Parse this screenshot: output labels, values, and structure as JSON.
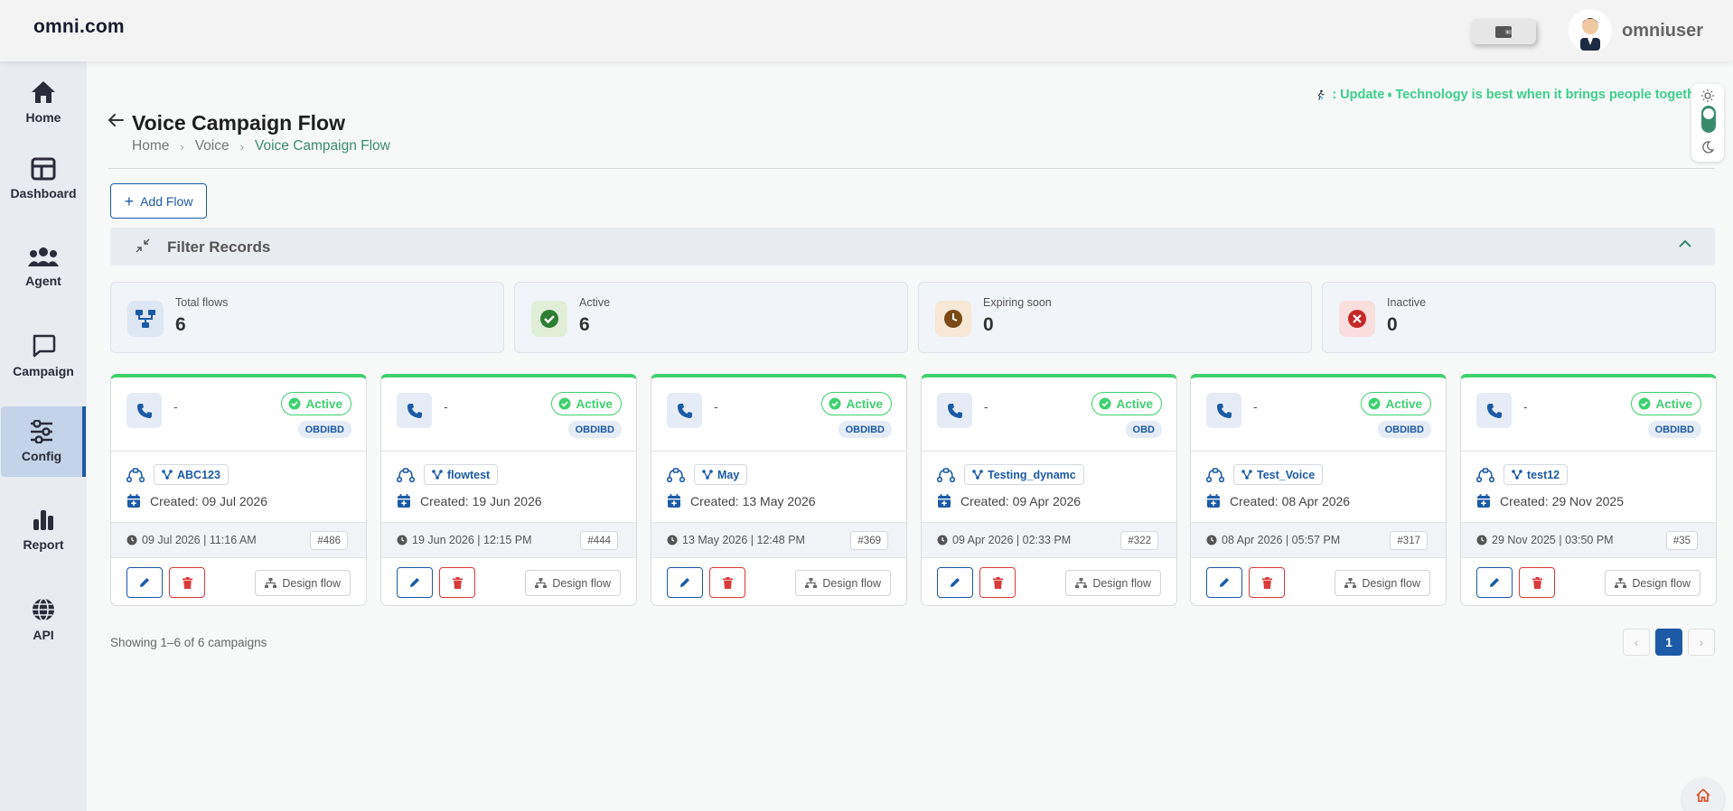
{
  "brand": "omni.com",
  "user": {
    "name": "omniuser"
  },
  "sidebar": {
    "items": [
      {
        "label": "Home",
        "icon": "home-icon"
      },
      {
        "label": "Dashboard",
        "icon": "dashboard-icon"
      },
      {
        "label": "Agent",
        "icon": "agents-icon"
      },
      {
        "label": "Campaign",
        "icon": "campaign-icon"
      },
      {
        "label": "Config",
        "icon": "config-icon",
        "active": true
      },
      {
        "label": "Report",
        "icon": "report-icon"
      },
      {
        "label": "API",
        "icon": "globe-icon"
      }
    ]
  },
  "ticker": {
    "label": ": Update",
    "text": "Technology is best when it brings people togeth"
  },
  "page": {
    "title": "Voice Campaign Flow",
    "breadcrumb": [
      "Home",
      "Voice",
      "Voice Campaign Flow"
    ],
    "add_flow": "Add Flow",
    "filter_label": "Filter Records"
  },
  "stats": [
    {
      "label": "Total flows",
      "value": "6",
      "icon": "flow-icon",
      "color": "#1c5aa6"
    },
    {
      "label": "Active",
      "value": "6",
      "icon": "check-circle-icon",
      "color": "#2e8b3d"
    },
    {
      "label": "Expiring soon",
      "value": "0",
      "icon": "clock-icon",
      "color": "#8a5a1c"
    },
    {
      "label": "Inactive",
      "value": "0",
      "icon": "x-circle-icon",
      "color": "#c0392b"
    }
  ],
  "flows": [
    {
      "name": "-",
      "status": "Active",
      "type": "OBDIBD",
      "flow": "ABC123",
      "created": "Created: 09 Jul 2026",
      "timestamp": "09 Jul 2026 | 11:16 AM",
      "id": "#486",
      "design": "Design flow"
    },
    {
      "name": "-",
      "status": "Active",
      "type": "OBDIBD",
      "flow": "flowtest",
      "created": "Created: 19 Jun 2026",
      "timestamp": "19 Jun 2026 | 12:15 PM",
      "id": "#444",
      "design": "Design flow"
    },
    {
      "name": "-",
      "status": "Active",
      "type": "OBDIBD",
      "flow": "May",
      "created": "Created: 13 May 2026",
      "timestamp": "13 May 2026 | 12:48 PM",
      "id": "#369",
      "design": "Design flow"
    },
    {
      "name": "-",
      "status": "Active",
      "type": "OBD",
      "flow": "Testing_dynamc",
      "created": "Created: 09 Apr 2026",
      "timestamp": "09 Apr 2026 | 02:33 PM",
      "id": "#322",
      "design": "Design flow"
    },
    {
      "name": "-",
      "status": "Active",
      "type": "OBDIBD",
      "flow": "Test_Voice",
      "created": "Created: 08 Apr 2026",
      "timestamp": "08 Apr 2026 | 05:57 PM",
      "id": "#317",
      "design": "Design flow"
    },
    {
      "name": "-",
      "status": "Active",
      "type": "OBDIBD",
      "flow": "test12",
      "created": "Created: 29 Nov 2025",
      "timestamp": "29 Nov 2025 | 03:50 PM",
      "id": "#35",
      "design": "Design flow"
    }
  ],
  "footer": {
    "showing": "Showing 1–6 of 6 campaigns",
    "pagination": {
      "prev": "‹",
      "current": "1",
      "next": "›"
    }
  },
  "colors": {
    "accent": "#1c5aa6",
    "active_green": "#3dd16f",
    "breadcrumb_green": "#3a8a6e",
    "danger": "#d93a3a"
  }
}
